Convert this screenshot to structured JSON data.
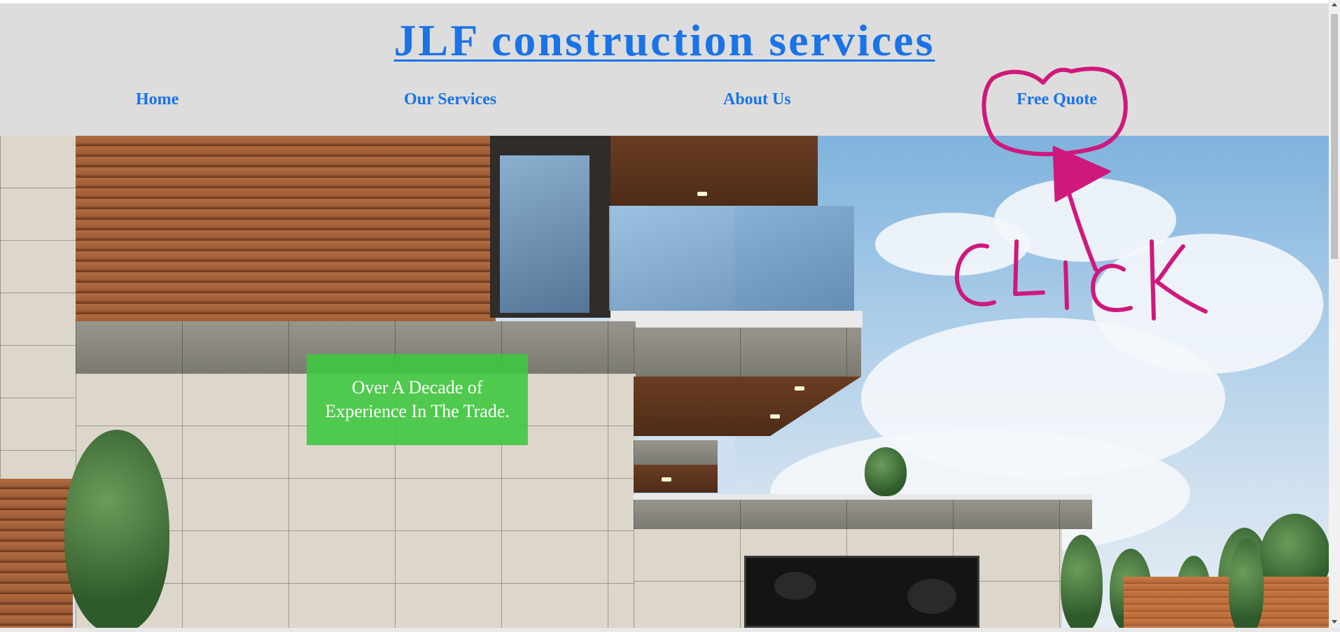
{
  "header": {
    "site_title": "JLF construction services",
    "nav": [
      {
        "label": "Home"
      },
      {
        "label": "Our Services"
      },
      {
        "label": "About Us"
      },
      {
        "label": "Free Quote"
      }
    ]
  },
  "hero": {
    "promo_text": "Over A Decade of Experience In The Trade.",
    "promo_color": "#3cc83c"
  },
  "annotation": {
    "text": "CLiCK",
    "color": "#d0187c"
  },
  "colors": {
    "link": "#1a73e8",
    "header_bg": "#dddddd"
  },
  "icons": [
    "scroll-up-arrow-icon",
    "scroll-down-arrow-icon"
  ]
}
